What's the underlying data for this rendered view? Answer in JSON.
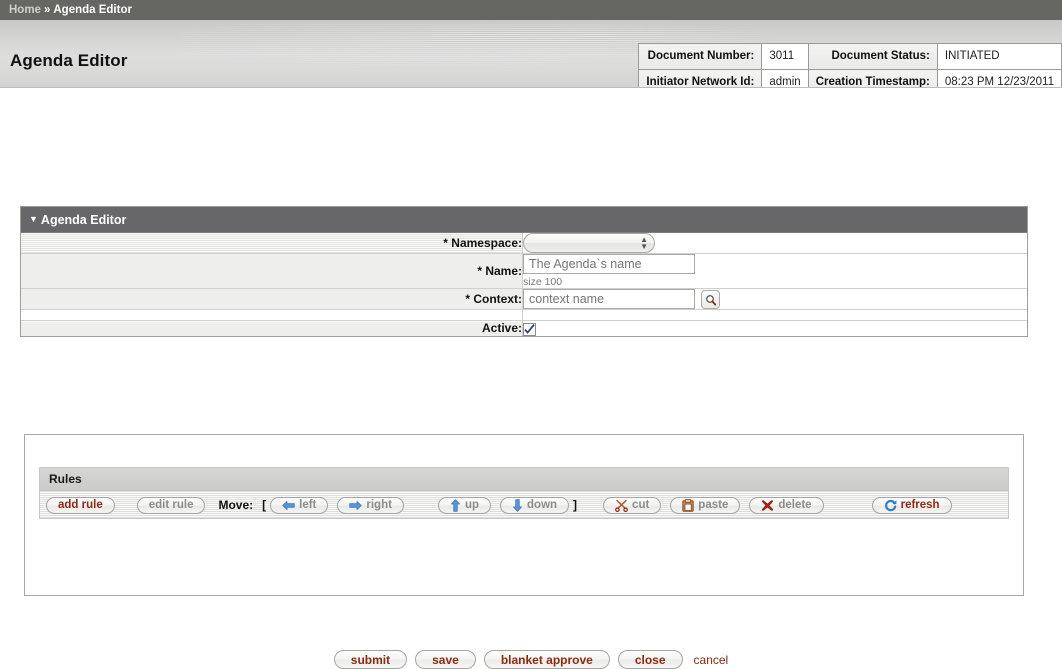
{
  "breadcrumb": {
    "home": "Home",
    "separator": "»",
    "current": "Agenda Editor"
  },
  "header": {
    "app_title": "Agenda Editor"
  },
  "doc_info": {
    "rows": [
      {
        "label1": "Document Number:",
        "value1": "3011",
        "label2": "Document Status:",
        "value2": "INITIATED"
      },
      {
        "label1": "Initiator Network Id:",
        "value1": "admin",
        "label2": "Creation Timestamp:",
        "value2": "08:23 PM 12/23/2011"
      }
    ]
  },
  "panel": {
    "title": "Agenda Editor",
    "fields": {
      "namespace_label": "* Namespace:",
      "namespace_value": "",
      "name_label": "* Name:",
      "name_placeholder": "The Agenda`s name",
      "name_hint": "size 100",
      "context_label": "* Context:",
      "context_placeholder": "context name",
      "active_label": "Active:",
      "active_checked": "true"
    }
  },
  "rules": {
    "title": "Rules",
    "move_label": "Move:",
    "bracket_open": "[",
    "bracket_close": "]",
    "buttons": {
      "add_rule": "add rule",
      "edit_rule": "edit rule",
      "left": "left",
      "right": "right",
      "up": "up",
      "down": "down",
      "cut": "cut",
      "paste": "paste",
      "delete": "delete",
      "refresh": "refresh"
    }
  },
  "footer": {
    "submit": "submit",
    "save": "save",
    "blanket_approve": "blanket approve",
    "close": "close",
    "cancel": "cancel"
  },
  "colors": {
    "breadcrumb_bg": "#666663",
    "panel_head_bg": "#67676a",
    "action_text": "#8b2b14",
    "disabled_text": "#8c8c8a",
    "arrow_blue": "#5a93d6"
  }
}
